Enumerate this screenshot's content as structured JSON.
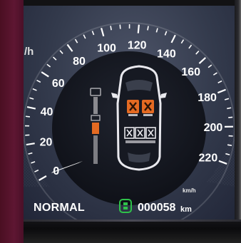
{
  "gauge": {
    "speed_labels": [
      "0",
      "20",
      "40",
      "60",
      "80",
      "100",
      "120",
      "140",
      "160",
      "180",
      "200",
      "220"
    ],
    "unit": "km/h",
    "partial_unit": "/h",
    "needle_value": 0
  },
  "status": {
    "drive_mode": "NORMAL",
    "odometer": "000058",
    "odometer_unit": "km"
  },
  "colors": {
    "warning_orange": "#e46a22",
    "odometer_icon_green": "#2fc24a",
    "scale_white": "#ffffff",
    "trim_maroon": "#5e1632"
  },
  "icons": [
    "seatbelt-indicator-icon",
    "car-topview-icon",
    "seat-occupied-warning-icon",
    "seat-empty-icon",
    "odometer-icon"
  ]
}
